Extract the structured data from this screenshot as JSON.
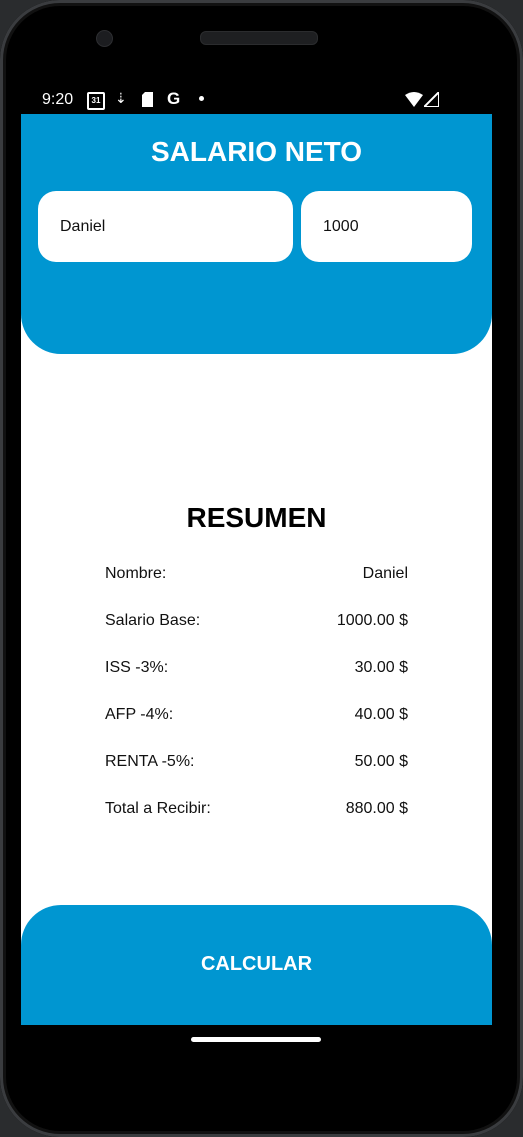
{
  "statusbar": {
    "time": "9:20",
    "icons": [
      "calendar-icon",
      "download-icon",
      "sd-card-icon",
      "google-icon",
      "dot-icon",
      "wifi-icon",
      "signal-icon"
    ],
    "calendar_day": "31",
    "google": "G"
  },
  "header": {
    "title": "SALARIO NETO",
    "name_value": "Daniel",
    "salary_value": "1000"
  },
  "resumen": {
    "title": "RESUMEN",
    "rows": [
      {
        "label": "Nombre:",
        "value": "Daniel"
      },
      {
        "label": "Salario Base:",
        "value": "1000.00 $"
      },
      {
        "label": "ISS -3%:",
        "value": "30.00 $"
      },
      {
        "label": "AFP -4%:",
        "value": "40.00 $"
      },
      {
        "label": "RENTA -5%:",
        "value": "50.00 $"
      },
      {
        "label": "Total a Recibir:",
        "value": "880.00 $"
      }
    ]
  },
  "button": {
    "label": "CALCULAR"
  },
  "colors": {
    "accent": "#0096d1",
    "background": "#ffffff"
  }
}
